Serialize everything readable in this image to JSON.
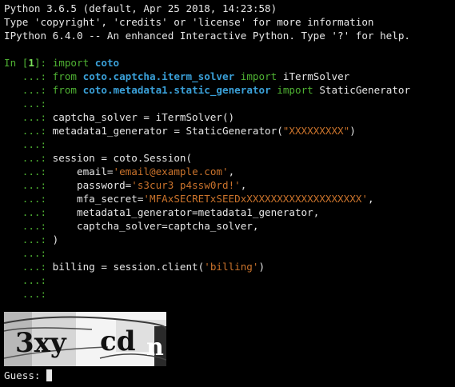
{
  "banner": {
    "line1": "Python 3.6.5 (default, Apr 25 2018, 14:23:58)",
    "line2": "Type 'copyright', 'credits' or 'license' for more information",
    "line3": "IPython 6.4.0 -- An enhanced Interactive Python. Type '?' for help."
  },
  "prompt": {
    "in_open": "In [",
    "in_number": "1",
    "in_close": "]: ",
    "continuation": "   ...: "
  },
  "code": {
    "l1_kw": "import",
    "l1_mod": "coto",
    "l2_from": "from",
    "l2_mod": "coto.captcha.iterm_solver",
    "l2_import": "import",
    "l2_name": "iTermSolver",
    "l3_from": "from",
    "l3_mod": "coto.metadata1.static_generator",
    "l3_import": "import",
    "l3_name": "StaticGenerator",
    "l5": "captcha_solver = iTermSolver()",
    "l6_pre": "metadata1_generator = StaticGenerator(",
    "l6_str": "\"XXXXXXXXX\"",
    "l6_post": ")",
    "l8": "session = coto.Session(",
    "l9_pre": "    email=",
    "l9_str": "'email@example.com'",
    "l9_post": ",",
    "l10_pre": "    password=",
    "l10_str": "'s3cur3 p4ssw0rd!'",
    "l10_post": ",",
    "l11_pre": "    mfa_secret=",
    "l11_str": "'MFAxSECRETxSEEDxXXXXXXXXXXXXXXXXXXX'",
    "l11_post": ",",
    "l12": "    metadata1_generator=metadata1_generator,",
    "l13": "    captcha_solver=captcha_solver,",
    "l14": ")",
    "l16_pre": "billing = session.client(",
    "l16_str": "'billing'",
    "l16_post": ")"
  },
  "captcha": {
    "text": "3xy cd n",
    "part1": "3xy",
    "part2": "cd",
    "part3": "n"
  },
  "input": {
    "label": "Guess: ",
    "value": ""
  },
  "colors": {
    "background": "#000000",
    "foreground": "#e6e6e6",
    "prompt_green": "#4fb233",
    "module_blue": "#3aa0d8",
    "string_orange": "#c9722b"
  }
}
